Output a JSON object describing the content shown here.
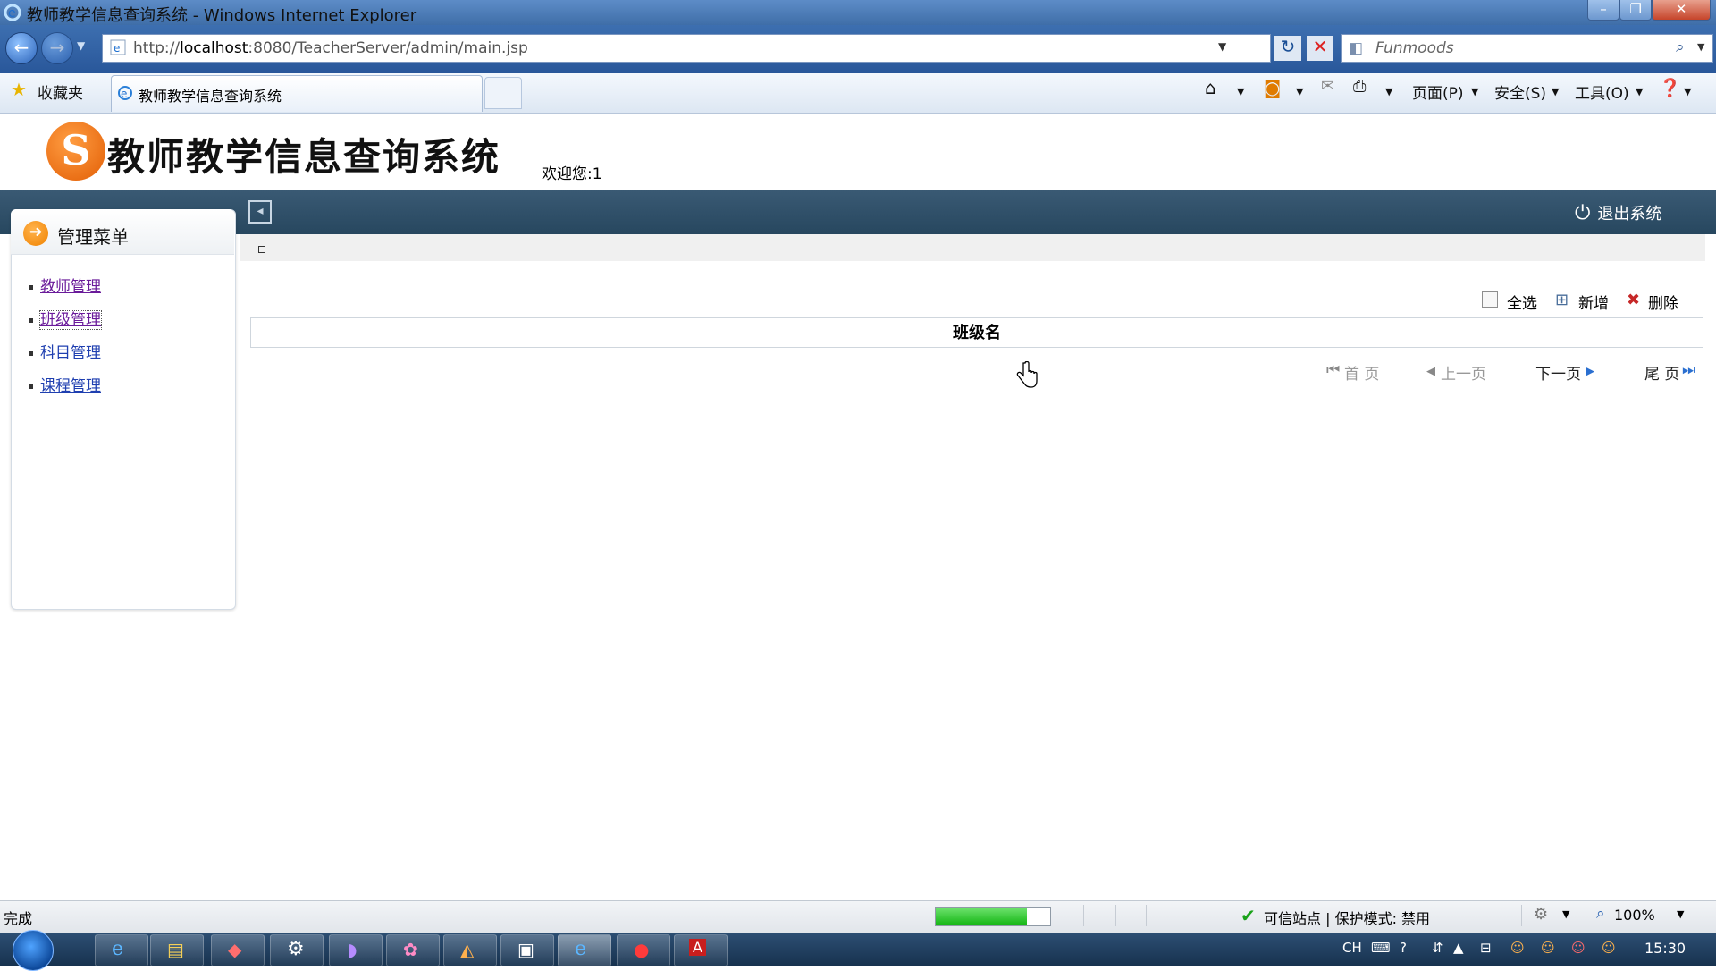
{
  "window": {
    "title": "教师教学信息查询系统 - Windows Internet Explorer",
    "buttons": [
      "–",
      "❐",
      "✕"
    ]
  },
  "browser": {
    "address_prefix": "http://",
    "address_host": "localhost",
    "address_rest": ":8080/TeacherServer/admin/main.jsp",
    "search_placeholder": "Funmoods",
    "favorites_label": "收藏夹",
    "tab_title": "教师教学信息查询系统",
    "menu_page": "页面(P)",
    "menu_safety": "安全(S)",
    "menu_tools": "工具(O)"
  },
  "app": {
    "title": "教师教学信息查询系统",
    "welcome": "欢迎您:1",
    "logout_label": "退出系统",
    "logo_letter": "S"
  },
  "sidebar": {
    "title": "管理菜单",
    "items": [
      {
        "label": "教师管理",
        "visited": true
      },
      {
        "label": "班级管理",
        "visited": true
      },
      {
        "label": "科目管理",
        "visited": false
      },
      {
        "label": "课程管理",
        "visited": false
      }
    ]
  },
  "toolbar": {
    "select_all": "全选",
    "add": "新增",
    "delete": "删除"
  },
  "table": {
    "columns": [
      "班级名"
    ],
    "rows": []
  },
  "pager": {
    "first": "首 页",
    "prev": "上一页",
    "next": "下一页",
    "last": "尾 页"
  },
  "status": {
    "left_text": "完成",
    "progress_fraction": 0.8,
    "zone_text": "可信站点 | 保护模式: 禁用",
    "zoom": "100%"
  },
  "taskbar": {
    "lang": "CH",
    "time": "15:30"
  },
  "colors": {
    "link": "#1f3fb0",
    "visited_link": "#6a1b9a",
    "nav_band": "#2f4f68",
    "accent_orange": "#f08200"
  }
}
